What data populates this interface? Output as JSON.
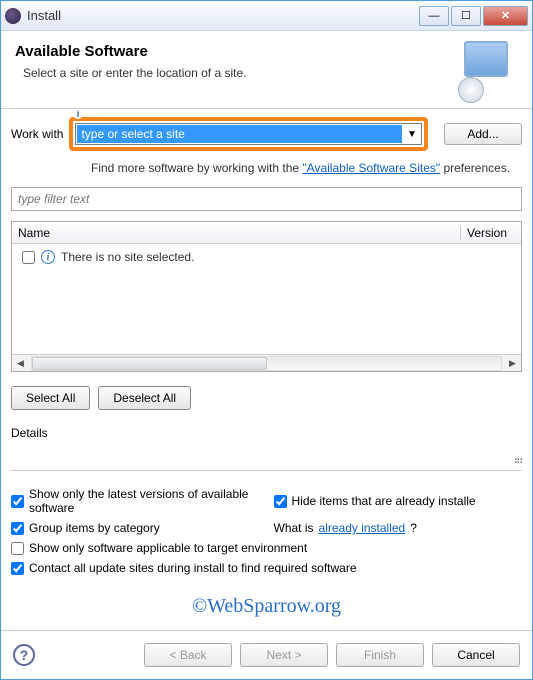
{
  "window": {
    "title": "Install"
  },
  "header": {
    "title": "Available Software",
    "subtitle": "Select a site or enter the location of a site."
  },
  "workwith": {
    "label": "Work with",
    "combo_value": "type or select a site",
    "add_label": "Add..."
  },
  "findmore": {
    "prefix": "Find more software by working with the ",
    "link": "\"Available Software Sites\"",
    "suffix": " preferences."
  },
  "filter": {
    "placeholder": "type filter text"
  },
  "tree": {
    "col_name": "Name",
    "col_version": "Version",
    "empty_msg": "There is no site selected."
  },
  "buttons": {
    "select_all": "Select All",
    "deselect_all": "Deselect All"
  },
  "details": {
    "label": "Details"
  },
  "options": {
    "latest": {
      "label": "Show only the latest versions of available software",
      "checked": true
    },
    "hide_installed": {
      "label": "Hide items that are already installe",
      "checked": true
    },
    "group": {
      "label": "Group items by category",
      "checked": true
    },
    "whatis_prefix": "What is ",
    "whatis_link": "already installed",
    "whatis_suffix": "?",
    "target_env": {
      "label": "Show only software applicable to target environment",
      "checked": false
    },
    "contact_all": {
      "label": "Contact all update sites during install to find required software",
      "checked": true
    }
  },
  "watermark": "©WebSparrow.org",
  "wizard": {
    "back": "< Back",
    "next": "Next >",
    "finish": "Finish",
    "cancel": "Cancel"
  }
}
